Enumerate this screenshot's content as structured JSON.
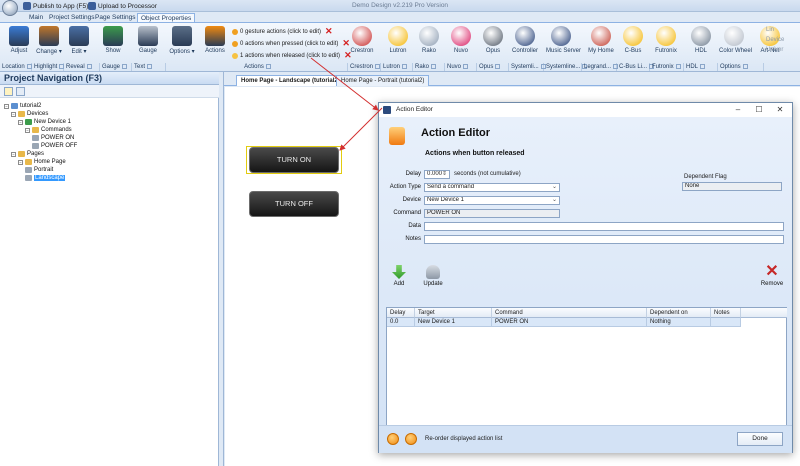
{
  "window": {
    "title": "Demo Design v2.219 Pro Version"
  },
  "quick_access": {
    "publish": "Publish to App (F5)",
    "upload": "Upload to Processor"
  },
  "ribbon_tabs": [
    "Main",
    "Project Settings",
    "Page Settings",
    "Object Properties"
  ],
  "ribbon": {
    "buttons": [
      {
        "label": "Adjust",
        "icon": "pin-icon",
        "color": "#3a7bd5"
      },
      {
        "label": "Change ▾",
        "icon": "paint-icon",
        "color": "#c0762b"
      },
      {
        "label": "Edit ▾",
        "icon": "edit-icon",
        "color": "#4a6fa5"
      },
      {
        "label": "Show",
        "icon": "show-icon",
        "color": "#3c9c4b"
      },
      {
        "label": "Gauge",
        "icon": "gauge-icon",
        "color": "#b9c1cc"
      },
      {
        "label": "Options ▾",
        "icon": "font-a-icon",
        "color": "#5b6f88"
      },
      {
        "label": "Actions",
        "icon": "actions-icon",
        "color": "#f08a10"
      }
    ],
    "actions": [
      "0 gesture actions (click to edit)",
      "0 actions when pressed (click to edit)",
      "1 actions when released (click to edit)"
    ],
    "brands": [
      {
        "label": "Crestron",
        "color": "#c62828"
      },
      {
        "label": "Lutron",
        "color": "#f4b400"
      },
      {
        "label": "Rako",
        "color": "#8a9bb0"
      },
      {
        "label": "Nuvo",
        "color": "#d81b60"
      },
      {
        "label": "Opus",
        "color": "#4b5563"
      },
      {
        "label": "Controller",
        "color": "#1f3b73"
      },
      {
        "label": "Music Server",
        "color": "#1f3b73"
      },
      {
        "label": "My Home",
        "color": "#c0392b"
      },
      {
        "label": "C-Bus",
        "color": "#f4b400"
      },
      {
        "label": "Futronix",
        "color": "#f4b400"
      },
      {
        "label": "HDL",
        "color": "#6b7a8c"
      },
      {
        "label": "Color Wheel",
        "color": "#b0b8c4"
      },
      {
        "label": "Art-Net",
        "color": "#f4b400"
      }
    ],
    "groups": [
      {
        "label": "Location"
      },
      {
        "label": "Highlight"
      },
      {
        "label": "Reveal"
      },
      {
        "label": "Gauge"
      },
      {
        "label": "Text"
      },
      {
        "label": "Actions"
      },
      {
        "label": "Crestron"
      },
      {
        "label": "Lutron"
      },
      {
        "label": "Rako"
      },
      {
        "label": "Nuvo"
      },
      {
        "label": "Opus"
      },
      {
        "label": "Systemli..."
      },
      {
        "label": "Systemline..."
      },
      {
        "label": "Legrand..."
      },
      {
        "label": "C-Bus Li..."
      },
      {
        "label": "Futronix"
      },
      {
        "label": "HDL"
      },
      {
        "label": "Options"
      }
    ],
    "overflow": [
      "Lin",
      "Device",
      "Univer"
    ]
  },
  "navigation": {
    "title": "Project Navigation (F3)",
    "tree": [
      {
        "label": "tutorial2",
        "level": 0,
        "icon_color": "#5b8fd0"
      },
      {
        "label": "Devices",
        "level": 1,
        "icon_color": "#e8b84a"
      },
      {
        "label": "New Device 1",
        "level": 2,
        "icon_color": "#3c9c4b"
      },
      {
        "label": "Commands",
        "level": 3,
        "icon_color": "#e8b84a"
      },
      {
        "label": "POWER ON",
        "level": 4,
        "icon_color": "#9aa6b4"
      },
      {
        "label": "POWER OFF",
        "level": 4,
        "icon_color": "#9aa6b4"
      },
      {
        "label": "Pages",
        "level": 1,
        "icon_color": "#e8b84a"
      },
      {
        "label": "Home Page",
        "level": 2,
        "icon_color": "#e8b84a"
      },
      {
        "label": "Portrait",
        "level": 3,
        "icon_color": "#9aa6b4"
      },
      {
        "label": "Landscape",
        "level": 3,
        "icon_color": "#9aa6b4",
        "selected": true
      }
    ]
  },
  "doc_tabs": [
    {
      "label": "Home Page - Landscape (tutorial2)",
      "active": true
    },
    {
      "label": "Home Page - Portrait (tutorial2)",
      "active": false
    }
  ],
  "canvas_buttons": {
    "on": "TURN ON",
    "off": "TURN OFF"
  },
  "dialog": {
    "title": "Action Editor",
    "heading": "Action Editor",
    "subheading": "Actions when button released",
    "delay_label": "Delay",
    "delay_value": "0.000",
    "delay_hint": "seconds (not cumulative)",
    "action_type_label": "Action Type",
    "action_type_value": "Send a command",
    "device_label": "Device",
    "device_value": "New Device 1",
    "command_label": "Command",
    "command_value": "POWER ON",
    "data_label": "Data",
    "data_value": "",
    "notes_label": "Notes",
    "notes_value": "",
    "dependent_flag_label": "Dependent Flag",
    "dependent_flag_value": "None",
    "add_label": "Add",
    "update_label": "Update",
    "remove_label": "Remove",
    "grid": {
      "columns": [
        "Delay",
        "Target",
        "Command",
        "Dependent on",
        "Notes"
      ],
      "rows": [
        [
          "0.0",
          "New Device 1",
          "POWER ON",
          "Nothing",
          ""
        ]
      ]
    },
    "reorder_label": "Re-order displayed action list",
    "done_label": "Done"
  }
}
